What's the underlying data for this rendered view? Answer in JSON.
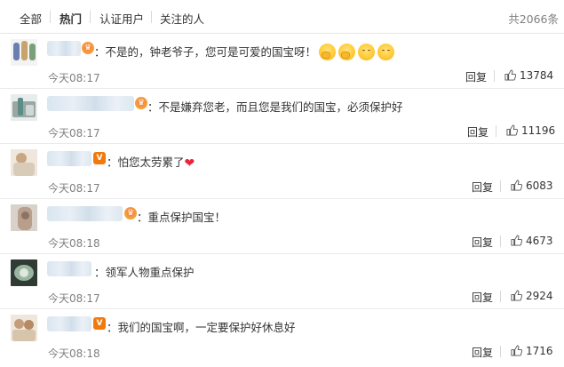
{
  "tabs": [
    {
      "label": "全部"
    },
    {
      "label": "热门"
    },
    {
      "label": "认证用户"
    },
    {
      "label": "关注的人"
    }
  ],
  "total": "共2066条",
  "reply_label": "回复",
  "comments": [
    {
      "text": "：不是的，钟老爷子，您可是可爱的国宝呀！",
      "time": "今天08:17",
      "likes": "13784",
      "badge": "crown",
      "emojis": [
        "think-icon",
        "think-icon",
        "smile-icon",
        "smile-icon"
      ]
    },
    {
      "text": "：不是嫌弃您老，而且您是我们的国宝，必须保护好",
      "time": "今天08:17",
      "likes": "11196",
      "badge": "crown",
      "emojis": []
    },
    {
      "text": "：怕您太劳累了",
      "time": "今天08:17",
      "likes": "6083",
      "badge": "v",
      "emojis": [
        "heart-icon"
      ]
    },
    {
      "text": "：重点保护国宝！",
      "time": "今天08:18",
      "likes": "4673",
      "badge": "crown",
      "emojis": []
    },
    {
      "text": "：领军人物重点保护",
      "time": "今天08:17",
      "likes": "2924",
      "badge": "none",
      "emojis": []
    },
    {
      "text": "：我们的国宝啊，一定要保护好休息好",
      "time": "今天08:18",
      "likes": "1716",
      "badge": "v",
      "emojis": []
    }
  ],
  "colors": {
    "badge_orange": "#f27a0c",
    "heart": "#e8253a",
    "muted": "#808080"
  }
}
